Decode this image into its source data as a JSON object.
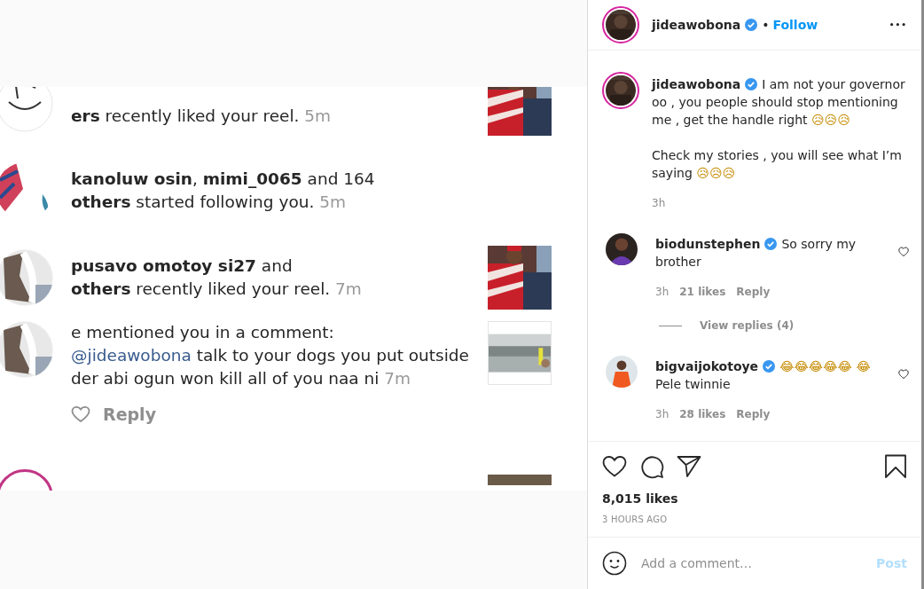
{
  "notifications": [
    {
      "kind": "like",
      "text": "**ers** recently liked your reel.",
      "time": "5m"
    },
    {
      "kind": "follow",
      "text": "**kanoluw osin**, **mimi_0065** and 164\n**others** started following you.",
      "time": "5m"
    },
    {
      "kind": "like",
      "text": "**pusavo omotoy si27** and\n**others** recently liked your reel.",
      "time": "7m"
    },
    {
      "kind": "mention",
      "text": "e mentioned you in a comment:",
      "mention": "@jideawobona",
      "comment": "talk to your dogs you put outside der abi ogun won kill all of you naa ni",
      "time": "7m",
      "reply": "Reply"
    },
    {
      "kind": "partial"
    }
  ],
  "post": {
    "username": "jideawobona",
    "verified": true,
    "dot": "•",
    "follow": "Follow",
    "more": "•••",
    "caption": {
      "username": "jideawobona",
      "verified": true,
      "paragraphs": [
        "I am not your governor oo , you people should stop mentioning me , get the handle right 😥😥😥",
        "Check my stories , you will see what I’m saying 😥😥😥"
      ],
      "time": "3h"
    },
    "comments": [
      {
        "username": "biodunstephen",
        "verified": true,
        "text": "So sorry my brother",
        "time": "3h",
        "likes": "21 likes",
        "reply": "Reply",
        "view_replies": "View replies (4)"
      },
      {
        "username": "bigvaijokotoye",
        "verified": true,
        "text": "😂😂😂😂😂 😂 Pele twinnie",
        "time": "3h",
        "likes": "28 likes",
        "reply": "Reply"
      }
    ],
    "likes": "8,015 likes",
    "age": "3 HOURS AGO",
    "comment_placeholder": "Add a comment…",
    "post_button": "Post"
  }
}
